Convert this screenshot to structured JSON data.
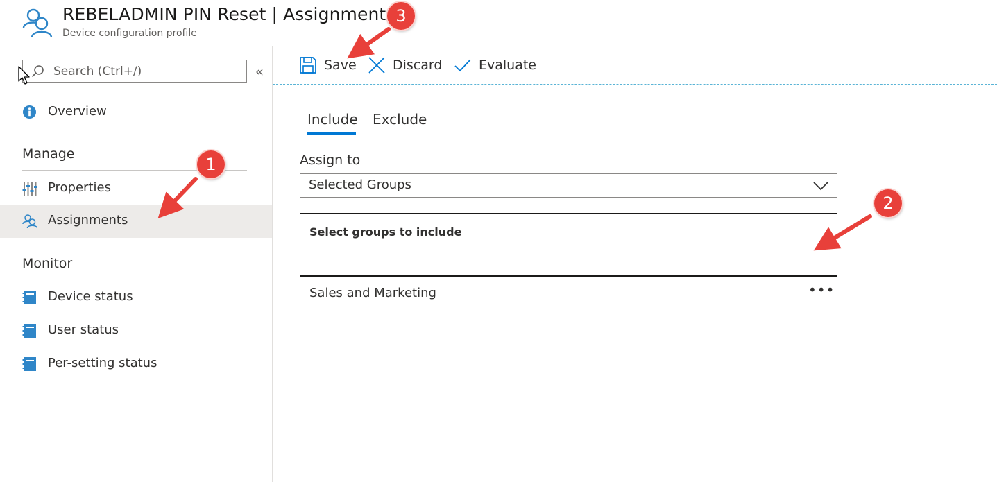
{
  "header": {
    "title": "REBELADMIN PIN Reset | Assignments",
    "subtitle": "Device configuration profile",
    "icon": "users-icon"
  },
  "sidebar": {
    "search": {
      "placeholder": "Search (Ctrl+/)",
      "value": ""
    },
    "collapse_label": "«",
    "overview": {
      "label": "Overview",
      "icon": "info-icon"
    },
    "manage": {
      "title": "Manage",
      "items": [
        {
          "label": "Properties",
          "icon": "sliders-icon"
        },
        {
          "label": "Assignments",
          "icon": "users-icon",
          "selected": true
        }
      ]
    },
    "monitor": {
      "title": "Monitor",
      "items": [
        {
          "label": "Device status",
          "icon": "notebook-icon"
        },
        {
          "label": "User status",
          "icon": "notebook-icon"
        },
        {
          "label": "Per-setting status",
          "icon": "notebook-icon"
        }
      ]
    }
  },
  "toolbar": {
    "save_label": "Save",
    "discard_label": "Discard",
    "evaluate_label": "Evaluate"
  },
  "tabs": {
    "include_label": "Include",
    "exclude_label": "Exclude",
    "active": "Include"
  },
  "assign": {
    "label": "Assign to",
    "selected": "Selected Groups"
  },
  "groups": {
    "header": "Select groups to include",
    "rows": [
      {
        "name": "Sales and Marketing",
        "more": "•••"
      }
    ]
  },
  "callouts": [
    "1",
    "2",
    "3"
  ],
  "colors": {
    "accent": "#0078d4",
    "icon_blue": "#2f86c8",
    "callout_red": "#e8403a",
    "selected_bg": "#edebe9"
  }
}
